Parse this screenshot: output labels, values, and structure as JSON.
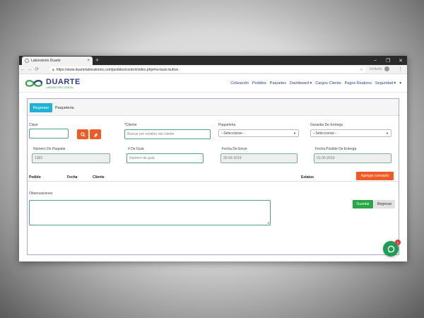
{
  "browser": {
    "tab_title": "Laboratorio Duarte",
    "tab_close": "×",
    "new_tab": "+",
    "url": "https://www.duartelaboratorios.com/pedidos/control/index.php#no-back-button",
    "profile_label": "Invitado"
  },
  "brand": {
    "title": "DUARTE",
    "subtitle": "LABORATORIO DENTAL"
  },
  "menu": {
    "items": [
      "Cotización",
      "Pedidos",
      "Paquetes",
      "Dashboard ▾",
      "Cargos Cliente",
      "Pagos Realizos",
      "Seguridad ▾",
      "▾"
    ]
  },
  "panel": {
    "back_top_label": "Regresar",
    "title": "Paqueteria"
  },
  "form": {
    "clave_label": "Clave",
    "cliente_label": "*Cliente",
    "cliente_placeholder": "Buscar por nombre del cliente",
    "paqueteria_label": "Paqueteria",
    "paqueteria_selected": "--Seleccionar--",
    "garantia_label": "Garantia De Entrega",
    "garantia_selected": "--Seleccionar--",
    "numero_paquete_label": "Número De Paquete",
    "numero_paquete_value": "1365",
    "guia_label": "# De Guia",
    "guia_placeholder": "Numero de guia",
    "fecha_envio_label": "Fecha De Envio",
    "fecha_envio_value": "30-04-2019",
    "fecha_entrega_label": "Fecha Posible De Entrega",
    "fecha_entrega_value": "01-05-2019"
  },
  "table": {
    "headers": [
      "Pedido",
      "Fecha",
      "Cliente",
      "Estatus"
    ],
    "add_button": "Agregar concepto"
  },
  "observaciones": {
    "label": "Observaciones"
  },
  "actions": {
    "save": "Guardar",
    "back": "Regresar"
  },
  "chat": {
    "badge_count": "1"
  },
  "colors": {
    "brand_blue": "#2e3d8a",
    "accent_cyan": "#20b2d6",
    "accent_orange": "#f05a24",
    "success_green": "#28a745"
  }
}
